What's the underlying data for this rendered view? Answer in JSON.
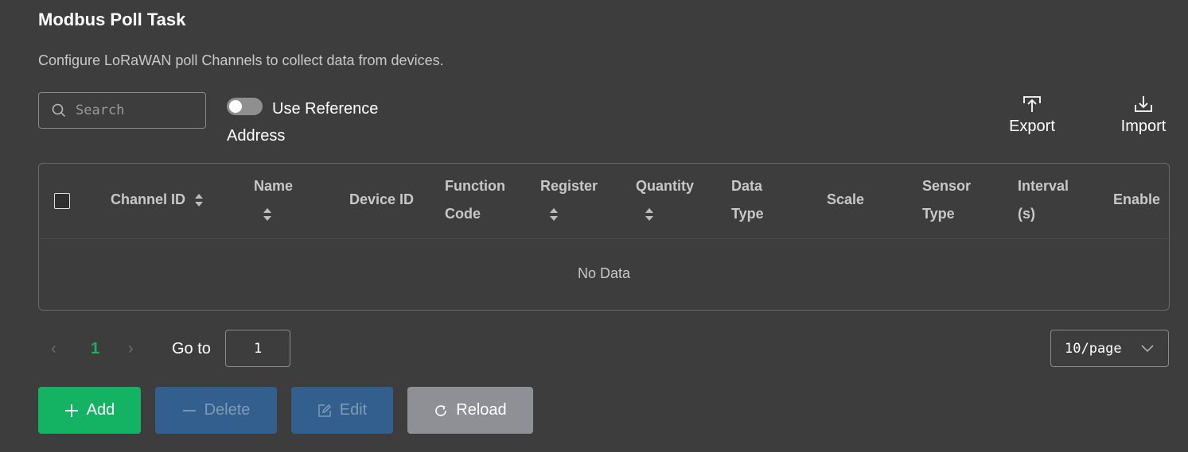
{
  "header": {
    "title": "Modbus Poll Task",
    "description": "Configure LoRaWAN poll Channels to collect data from devices."
  },
  "toolbar": {
    "search_placeholder": "Search",
    "toggle_label": "Use Reference Address",
    "toggle_on": false,
    "export_label": "Export",
    "import_label": "Import"
  },
  "table": {
    "columns": [
      {
        "line1": "Channel ID",
        "line2": "",
        "sortable": true
      },
      {
        "line1": "Name",
        "line2": "",
        "sortable": true
      },
      {
        "line1": "Device ID",
        "line2": "",
        "sortable": false
      },
      {
        "line1": "Function",
        "line2": "Code",
        "sortable": false
      },
      {
        "line1": "Register",
        "line2": "",
        "sortable": true
      },
      {
        "line1": "Quantity",
        "line2": "",
        "sortable": true
      },
      {
        "line1": "Data",
        "line2": "Type",
        "sortable": false
      },
      {
        "line1": "Scale",
        "line2": "",
        "sortable": false
      },
      {
        "line1": "Sensor",
        "line2": "Type",
        "sortable": false
      },
      {
        "line1": "Interval",
        "line2": "(s)",
        "sortable": false
      },
      {
        "line1": "Enable",
        "line2": "",
        "sortable": false
      }
    ],
    "rows": [],
    "empty_text": "No Data"
  },
  "pagination": {
    "current_page": "1",
    "goto_label": "Go to",
    "goto_value": "1",
    "page_size": "10/page"
  },
  "actions": {
    "add_label": "Add",
    "delete_label": "Delete",
    "edit_label": "Edit",
    "reload_label": "Reload"
  },
  "colors": {
    "background": "#3d3d3d",
    "primary_green": "#14b363",
    "disabled_blue": "#325f8e",
    "reload_gray": "#8e9096"
  }
}
